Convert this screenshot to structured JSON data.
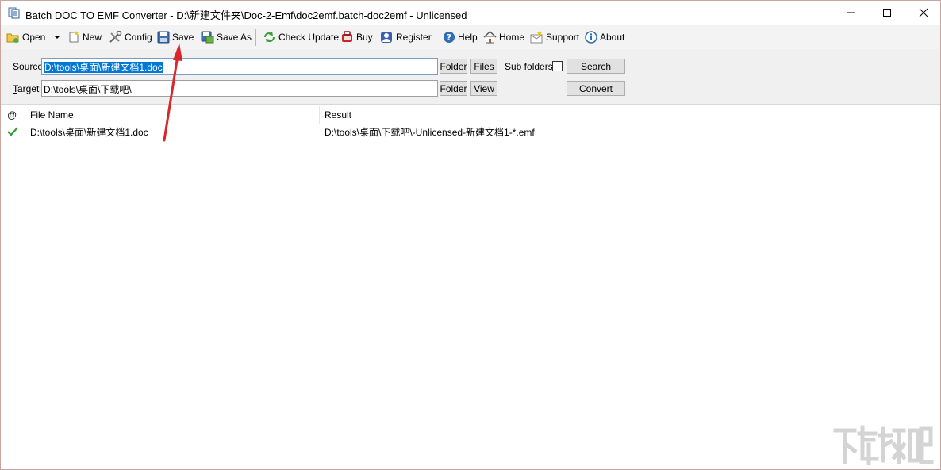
{
  "window": {
    "title": "Batch DOC TO EMF Converter - D:\\新建文件夹\\Doc-2-Emf\\doc2emf.batch-doc2emf - Unlicensed"
  },
  "toolbar": {
    "open": "Open",
    "new": "New",
    "config": "Config",
    "save": "Save",
    "save_as": "Save As",
    "check_update": "Check Update",
    "buy": "Buy",
    "register": "Register",
    "help": "Help",
    "home": "Home",
    "support": "Support",
    "about": "About"
  },
  "form": {
    "source_label_accel": "S",
    "source_label_rest": "ource",
    "source_value": "D:\\tools\\桌面\\新建文档1.doc",
    "target_label_accel": "T",
    "target_label_rest": "arget",
    "target_value": "D:\\tools\\桌面\\下载吧\\",
    "folder": "Folder",
    "files": "Files",
    "view": "View",
    "sub_folders": "Sub folders",
    "sub_folders_checked": false,
    "search": "Search",
    "convert": "Convert"
  },
  "grid": {
    "columns": [
      "@",
      "File Name",
      "Result"
    ],
    "rows": [
      {
        "status": "success",
        "file_name": "D:\\tools\\桌面\\新建文档1.doc",
        "result": "D:\\tools\\桌面\\下载吧\\-Unlicensed-新建文档1-*.emf"
      }
    ]
  },
  "colors": {
    "selection": "#0078d7",
    "check": "#3a9a3a",
    "arrow": "#d9262b"
  }
}
